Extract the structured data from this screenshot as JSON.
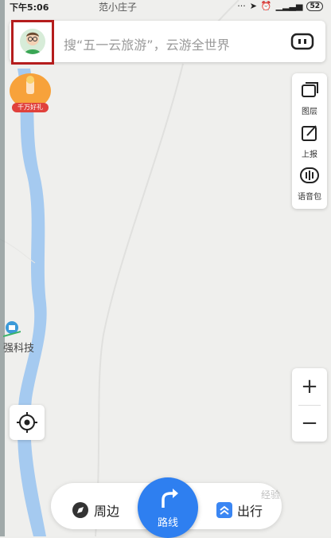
{
  "status_bar": {
    "time": "下午5:06",
    "place": "范小庄子",
    "battery": "52"
  },
  "search": {
    "placeholder": "搜“五一云旅游”，云游全世界"
  },
  "promo": {
    "badge": "千万好礼"
  },
  "tools": {
    "layers_label": "图层",
    "report_label": "上报",
    "voice_pack_label": "语音包"
  },
  "map": {
    "poi_label": "强科技",
    "river_color": "#9cc5f0"
  },
  "zoom": {
    "in_label": "+",
    "out_label": "−"
  },
  "bottom_bar": {
    "nearby_label": "周边",
    "route_label": "路线",
    "travel_label": "出行"
  },
  "watermark": "经验",
  "colors": {
    "accent": "#2e7ff0",
    "highlight_border": "#b51d1d"
  }
}
